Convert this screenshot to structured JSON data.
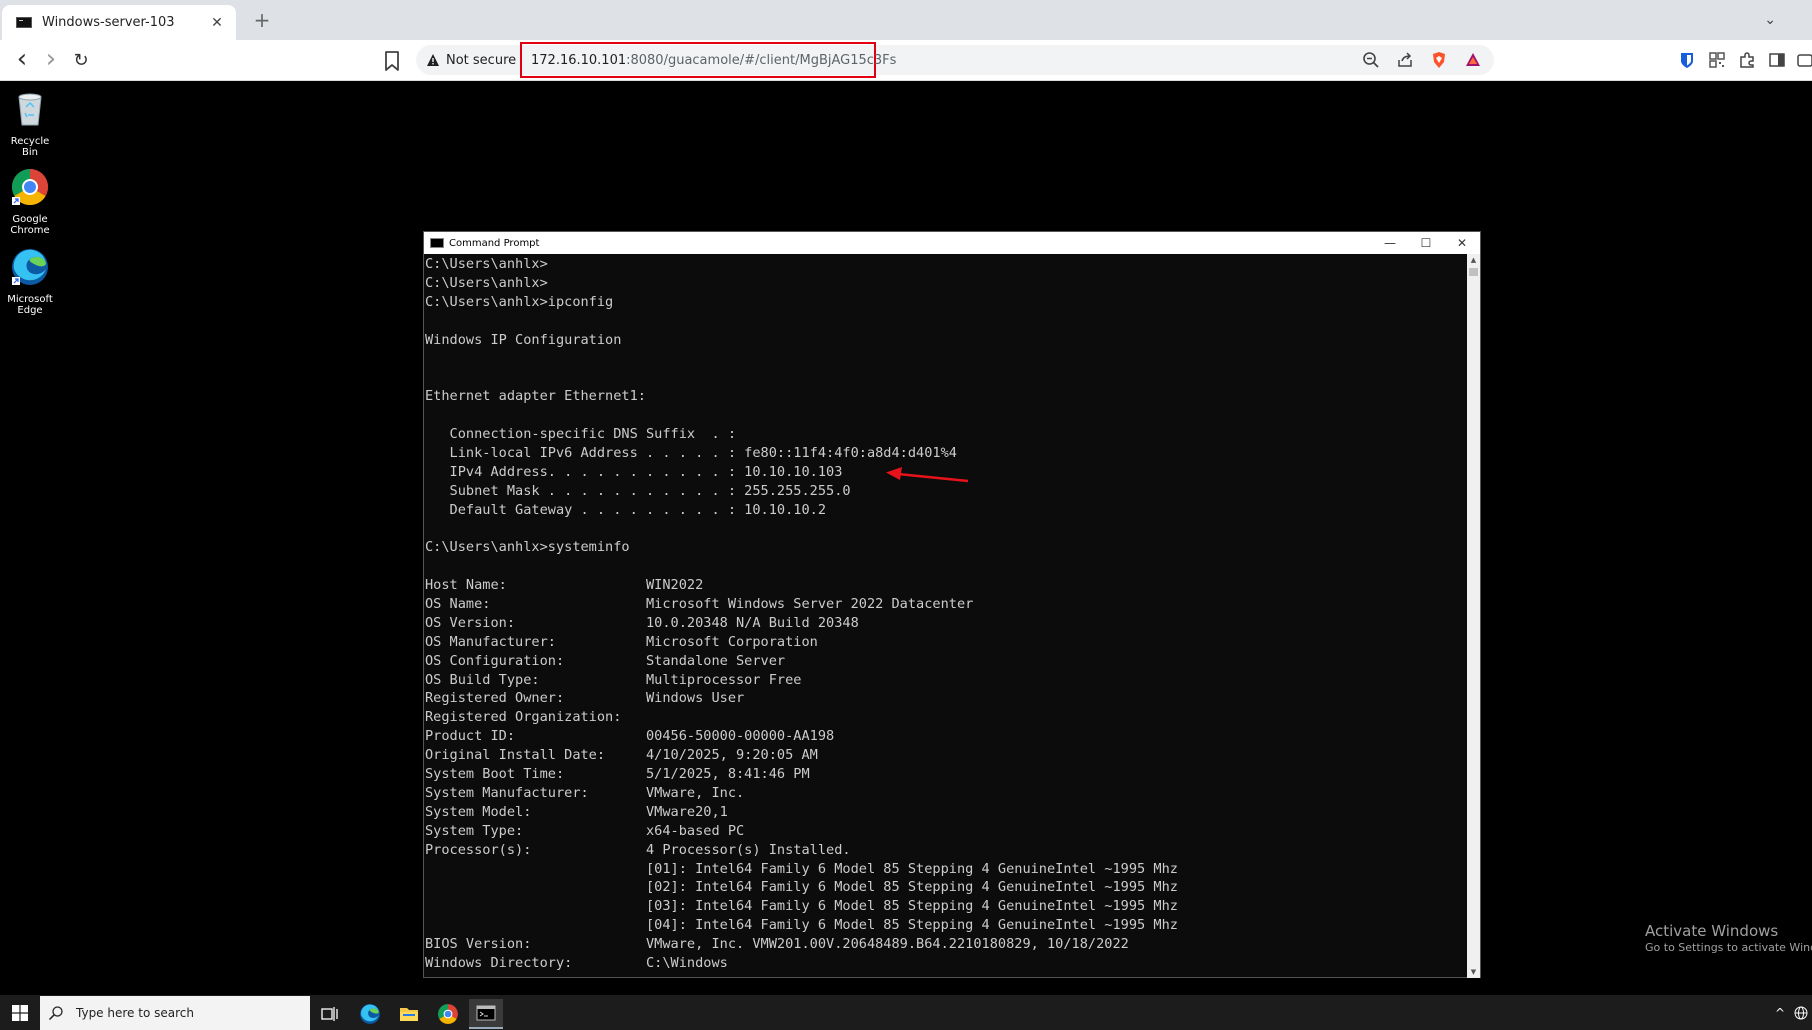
{
  "browser": {
    "tab": {
      "title": "Windows-server-103",
      "close_glyph": "✕"
    },
    "new_tab_glyph": "+",
    "tab_dropdown_glyph": "⌄",
    "nav": {
      "back_glyph": "‹",
      "forward_glyph": "›",
      "reload_glyph": "↻"
    },
    "security_label": "Not secure",
    "url_host": "172.16.10.101",
    "url_rest": ":8080/guacamole/#/client/MgBjAG15c3Fs",
    "url_highlight_color": "#e0000f",
    "icons": [
      "bookmark-icon",
      "warning-icon",
      "zoom-out-icon",
      "share-icon",
      "brave-shield-icon",
      "brave-rewards-icon",
      "bitwarden-icon",
      "qr-icon",
      "extensions-icon",
      "sidebar-icon",
      "wallet-icon"
    ]
  },
  "desktop": {
    "icons": [
      {
        "label": "Recycle Bin",
        "icon": "recycle-bin-icon"
      },
      {
        "label": "Google Chrome",
        "icon": "chrome-icon"
      },
      {
        "label": "Microsoft Edge",
        "icon": "edge-icon"
      }
    ]
  },
  "cmd_window": {
    "title": "Command Prompt",
    "controls": {
      "minimize": "—",
      "maximize": "☐",
      "close": "✕"
    },
    "lines": [
      "C:\\Users\\anhlx>",
      "C:\\Users\\anhlx>",
      "C:\\Users\\anhlx>ipconfig",
      "",
      "Windows IP Configuration",
      "",
      "",
      "Ethernet adapter Ethernet1:",
      "",
      "   Connection-specific DNS Suffix  . :",
      "   Link-local IPv6 Address . . . . . : fe80::11f4:4f0:a8d4:d401%4",
      "   IPv4 Address. . . . . . . . . . . : 10.10.10.103",
      "   Subnet Mask . . . . . . . . . . . : 255.255.255.0",
      "   Default Gateway . . . . . . . . . : 10.10.10.2",
      "",
      "C:\\Users\\anhlx>systeminfo",
      "",
      "Host Name:                 WIN2022",
      "OS Name:                   Microsoft Windows Server 2022 Datacenter",
      "OS Version:                10.0.20348 N/A Build 20348",
      "OS Manufacturer:           Microsoft Corporation",
      "OS Configuration:          Standalone Server",
      "OS Build Type:             Multiprocessor Free",
      "Registered Owner:          Windows User",
      "Registered Organization:",
      "Product ID:                00456-50000-00000-AA198",
      "Original Install Date:     4/10/2025, 9:20:05 AM",
      "System Boot Time:          5/1/2025, 8:41:46 PM",
      "System Manufacturer:       VMware, Inc.",
      "System Model:              VMware20,1",
      "System Type:               x64-based PC",
      "Processor(s):              4 Processor(s) Installed.",
      "                           [01]: Intel64 Family 6 Model 85 Stepping 4 GenuineIntel ~1995 Mhz",
      "                           [02]: Intel64 Family 6 Model 85 Stepping 4 GenuineIntel ~1995 Mhz",
      "                           [03]: Intel64 Family 6 Model 85 Stepping 4 GenuineIntel ~1995 Mhz",
      "                           [04]: Intel64 Family 6 Model 85 Stepping 4 GenuineIntel ~1995 Mhz",
      "BIOS Version:              VMware, Inc. VMW201.00V.20648489.B64.2210180829, 10/18/2022",
      "Windows Directory:         C:\\Windows"
    ],
    "annotation": {
      "icon": "red-arrow-icon",
      "color": "#e8121b"
    }
  },
  "watermark": {
    "line1": "Activate Windows",
    "line2": "Go to Settings to activate Windo"
  },
  "taskbar": {
    "search_placeholder": "Type here to search",
    "apps": [
      "task-view-icon",
      "edge-icon",
      "file-explorer-icon",
      "chrome-icon",
      "command-prompt-icon"
    ],
    "tray_glyph": "^"
  }
}
